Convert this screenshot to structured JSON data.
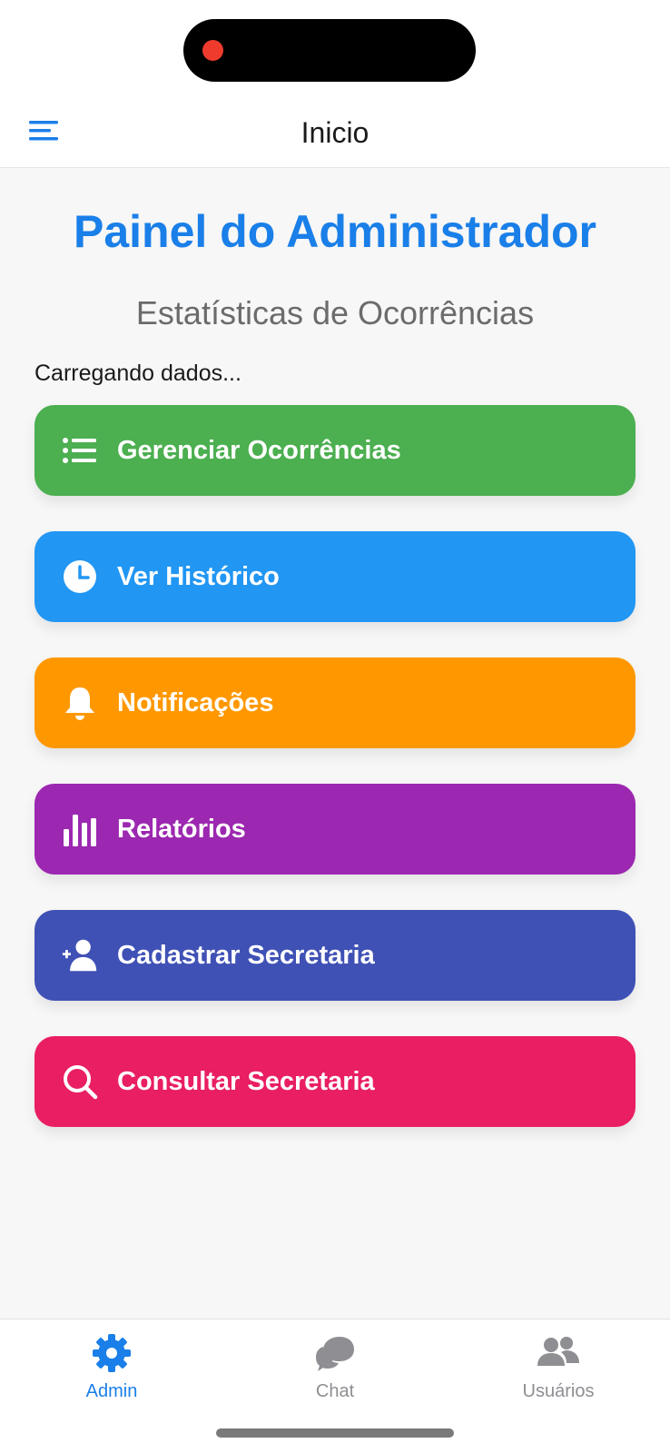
{
  "header": {
    "title": "Inicio",
    "menu_icon": "menu-icon"
  },
  "main": {
    "title": "Painel do Administrador",
    "subtitle": "Estatísticas de Ocorrências",
    "loading_text": "Carregando dados..."
  },
  "actions": [
    {
      "label": "Gerenciar Ocorrências",
      "icon": "list-icon",
      "color": "#4caf50"
    },
    {
      "label": "Ver Histórico",
      "icon": "clock-icon",
      "color": "#2196f3"
    },
    {
      "label": "Notificações",
      "icon": "bell-icon",
      "color": "#ff9800"
    },
    {
      "label": "Relatórios",
      "icon": "bar-chart-icon",
      "color": "#9c27b0"
    },
    {
      "label": "Cadastrar Secretaria",
      "icon": "add-user-icon",
      "color": "#3f51b5"
    },
    {
      "label": "Consultar Secretaria",
      "icon": "search-icon",
      "color": "#e91e63"
    }
  ],
  "bottom_nav": {
    "items": [
      {
        "label": "Admin",
        "icon": "gear-icon",
        "active": true
      },
      {
        "label": "Chat",
        "icon": "chat-icon",
        "active": false
      },
      {
        "label": "Usuários",
        "icon": "users-icon",
        "active": false
      }
    ],
    "active_color": "#1a7fe8",
    "inactive_color": "#8e8e93"
  }
}
